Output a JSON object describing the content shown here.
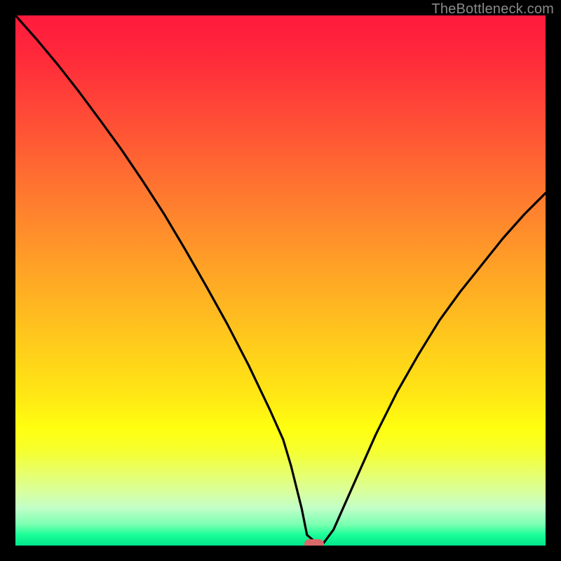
{
  "watermark": "TheBottleneck.com",
  "chart_data": {
    "type": "line",
    "title": "",
    "xlabel": "",
    "ylabel": "",
    "xlim": [
      0,
      100
    ],
    "ylim": [
      0,
      100
    ],
    "grid": false,
    "series": [
      {
        "name": "curve",
        "x": [
          0,
          4,
          8,
          12,
          16,
          20,
          24,
          28,
          32,
          36,
          40,
          44,
          48,
          50.5,
          52,
          54,
          55,
          57,
          58,
          60,
          64,
          68,
          72,
          76,
          80,
          84,
          88,
          92,
          96,
          100
        ],
        "y": [
          100,
          95.5,
          90.7,
          85.6,
          80.2,
          74.7,
          68.8,
          62.6,
          55.9,
          48.9,
          41.7,
          34.0,
          25.6,
          20.0,
          15.0,
          7.0,
          2.0,
          0.3,
          0.3,
          3.0,
          12.0,
          21.0,
          29.0,
          36.0,
          42.5,
          48.0,
          53.0,
          58.0,
          62.5,
          66.5
        ]
      }
    ],
    "marker": {
      "x": 56.3,
      "y": 0.3
    },
    "background_gradient": {
      "top": "#ff1a3d",
      "mid": "#ffd11a",
      "bottom": "#00e68a"
    }
  }
}
